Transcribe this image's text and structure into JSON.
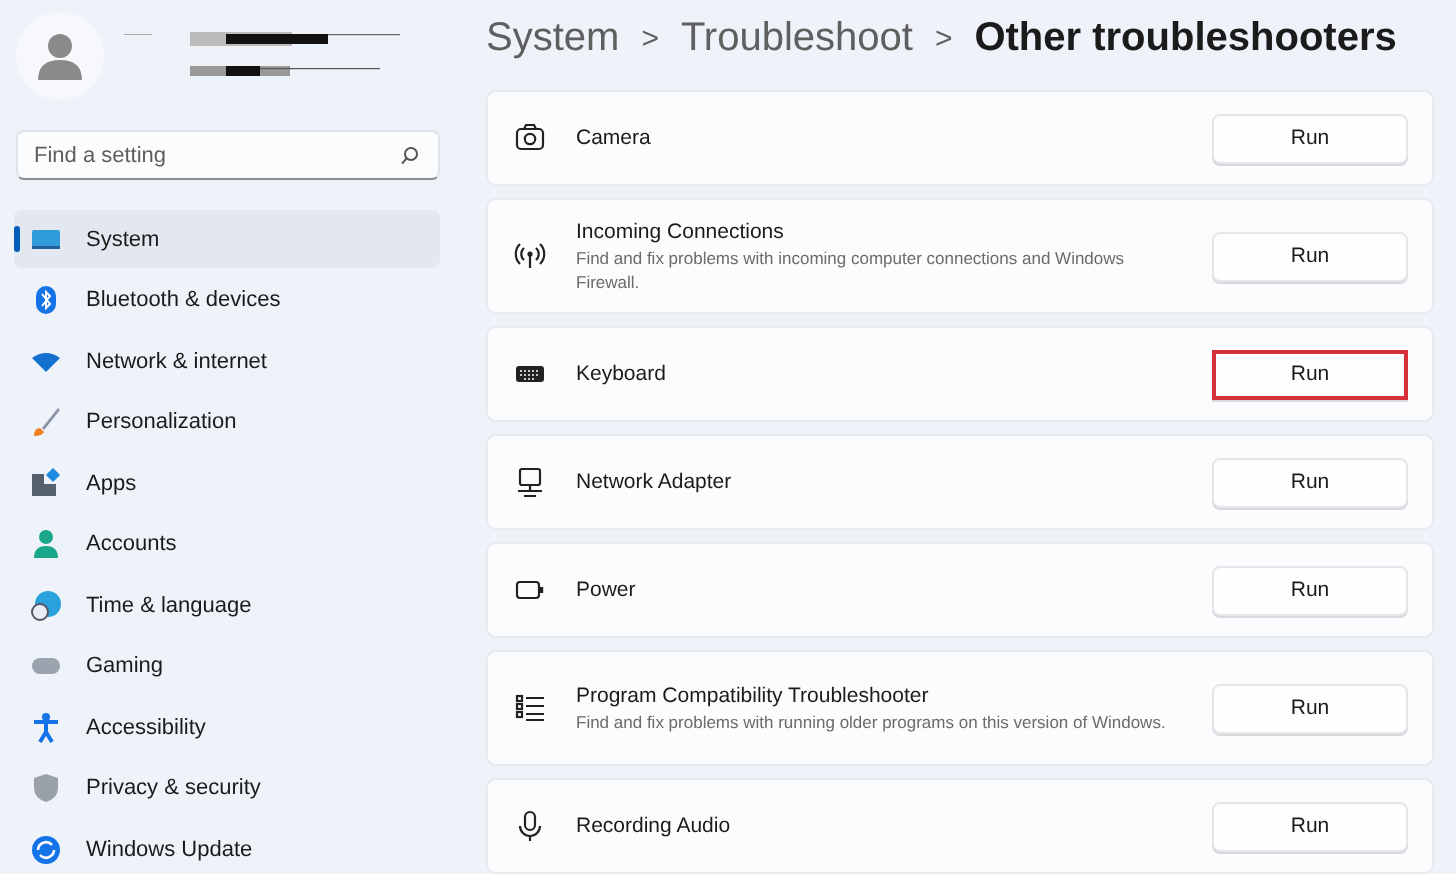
{
  "search": {
    "placeholder": "Find a setting"
  },
  "sidebar": {
    "items": [
      {
        "label": "System",
        "selected": true
      },
      {
        "label": "Bluetooth & devices",
        "selected": false
      },
      {
        "label": "Network & internet",
        "selected": false
      },
      {
        "label": "Personalization",
        "selected": false
      },
      {
        "label": "Apps",
        "selected": false
      },
      {
        "label": "Accounts",
        "selected": false
      },
      {
        "label": "Time & language",
        "selected": false
      },
      {
        "label": "Gaming",
        "selected": false
      },
      {
        "label": "Accessibility",
        "selected": false
      },
      {
        "label": "Privacy & security",
        "selected": false
      },
      {
        "label": "Windows Update",
        "selected": false
      }
    ]
  },
  "breadcrumb": {
    "items": [
      "System",
      "Troubleshoot"
    ],
    "separator": ">",
    "current": "Other troubleshooters"
  },
  "troubleshooters": [
    {
      "title": "Camera",
      "button": "Run",
      "highlighted": false
    },
    {
      "title": "Incoming Connections",
      "description": "Find and fix problems with incoming computer connections and Windows Firewall.",
      "button": "Run",
      "highlighted": false
    },
    {
      "title": "Keyboard",
      "button": "Run",
      "highlighted": true
    },
    {
      "title": "Network Adapter",
      "button": "Run",
      "highlighted": false
    },
    {
      "title": "Power",
      "button": "Run",
      "highlighted": false
    },
    {
      "title": "Program Compatibility Troubleshooter",
      "description": "Find and fix problems with running older programs on this version of Windows.",
      "button": "Run",
      "highlighted": false
    },
    {
      "title": "Recording Audio",
      "button": "Run",
      "highlighted": false
    }
  ]
}
